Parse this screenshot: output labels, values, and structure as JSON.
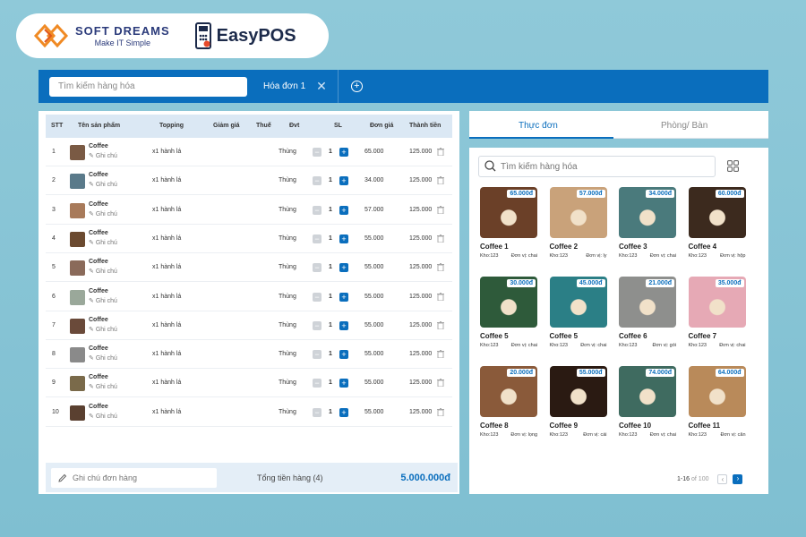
{
  "brand": {
    "softdreams_title": "SOFT DREAMS",
    "softdreams_slogan": "Make IT Simple",
    "easypos": "EasyPOS"
  },
  "topbar": {
    "search_placeholder": "Tìm kiếm hàng hóa",
    "invoice_tab": "Hóa đơn 1",
    "accent": "#0a6ebd"
  },
  "table": {
    "headers": [
      "STT",
      "Tên sản phẩm",
      "Topping",
      "Giảm giá",
      "Thuế",
      "Đvt",
      "SL",
      "Đơn giá",
      "Thành tiền"
    ],
    "rows": [
      {
        "stt": "1",
        "name": "Coffee",
        "note": "Ghi chú",
        "topping": "x1 hành lá",
        "unit": "Thùng",
        "qty": "1",
        "price": "65.000",
        "total": "125.000"
      },
      {
        "stt": "2",
        "name": "Coffee",
        "note": "Ghi chú",
        "topping": "x1 hành lá",
        "unit": "Thùng",
        "qty": "1",
        "price": "34.000",
        "total": "125.000"
      },
      {
        "stt": "3",
        "name": "Coffee",
        "note": "Ghi chú",
        "topping": "x1 hành lá",
        "unit": "Thùng",
        "qty": "1",
        "price": "57.000",
        "total": "125.000"
      },
      {
        "stt": "4",
        "name": "Coffee",
        "note": "Ghi chú",
        "topping": "x1 hành lá",
        "unit": "Thùng",
        "qty": "1",
        "price": "55.000",
        "total": "125.000"
      },
      {
        "stt": "5",
        "name": "Coffee",
        "note": "Ghi chú",
        "topping": "x1 hành lá",
        "unit": "Thùng",
        "qty": "1",
        "price": "55.000",
        "total": "125.000"
      },
      {
        "stt": "6",
        "name": "Coffee",
        "note": "Ghi chú",
        "topping": "x1 hành lá",
        "unit": "Thùng",
        "qty": "1",
        "price": "55.000",
        "total": "125.000"
      },
      {
        "stt": "7",
        "name": "Coffee",
        "note": "Ghi chú",
        "topping": "x1 hành lá",
        "unit": "Thùng",
        "qty": "1",
        "price": "55.000",
        "total": "125.000"
      },
      {
        "stt": "8",
        "name": "Coffee",
        "note": "Ghi chú",
        "topping": "x1 hành lá",
        "unit": "Thùng",
        "qty": "1",
        "price": "55.000",
        "total": "125.000"
      },
      {
        "stt": "9",
        "name": "Coffee",
        "note": "Ghi chú",
        "topping": "x1 hành lá",
        "unit": "Thùng",
        "qty": "1",
        "price": "55.000",
        "total": "125.000"
      },
      {
        "stt": "10",
        "name": "Coffee",
        "note": "Ghi chú",
        "topping": "x1 hành lá",
        "unit": "Thùng",
        "qty": "1",
        "price": "55.000",
        "total": "125.000"
      }
    ]
  },
  "footer": {
    "order_note_placeholder": "Ghi chú đơn hàng",
    "total_label": "Tổng tiền hàng (4)",
    "total_value": "5.000.000đ"
  },
  "tabs": {
    "menu": "Thực đơn",
    "tables": "Phòng/ Bàn"
  },
  "menu": {
    "search_placeholder": "Tìm kiếm hàng hóa",
    "items": [
      {
        "name": "Coffee 1",
        "price": "65.000đ",
        "stock": "Kho:123",
        "unit": "Đơn vị: chai",
        "img_color": "#6b4028"
      },
      {
        "name": "Coffee 2",
        "price": "57.000đ",
        "stock": "Kho:123",
        "unit": "Đơn vị: ly",
        "img_color": "#c9a27a"
      },
      {
        "name": "Coffee 3",
        "price": "34.000đ",
        "stock": "Kho:123",
        "unit": "Đơn vị: chai",
        "img_color": "#4a7a7c"
      },
      {
        "name": "Coffee 4",
        "price": "60.000đ",
        "stock": "Kho:123",
        "unit": "Đơn vị: hộp",
        "img_color": "#3c2a1e"
      },
      {
        "name": "Coffee 5",
        "price": "30.000đ",
        "stock": "Kho:123",
        "unit": "Đơn vị: chai",
        "img_color": "#2e5a3a"
      },
      {
        "name": "Coffee 5",
        "price": "45.000đ",
        "stock": "Kho:123",
        "unit": "Đơn vị: chai",
        "img_color": "#2b7f86"
      },
      {
        "name": "Coffee 6",
        "price": "21.000đ",
        "stock": "Kho:123",
        "unit": "Đơn vị: gói",
        "img_color": "#8e8f8d"
      },
      {
        "name": "Coffee 7",
        "price": "35.000đ",
        "stock": "Kho:123",
        "unit": "Đơn vị: chai",
        "img_color": "#e6a9b5"
      },
      {
        "name": "Coffee 8",
        "price": "20.000đ",
        "stock": "Kho:123",
        "unit": "Đơn vị: lọng",
        "img_color": "#8a5a3a"
      },
      {
        "name": "Coffee 9",
        "price": "55.000đ",
        "stock": "Kho:123",
        "unit": "Đơn vị: cái",
        "img_color": "#2a1a12"
      },
      {
        "name": "Coffee 10",
        "price": "74.000đ",
        "stock": "Kho:123",
        "unit": "Đơn vị: chai",
        "img_color": "#3f6b60"
      },
      {
        "name": "Coffee 11",
        "price": "64.000đ",
        "stock": "Kho:123",
        "unit": "Đơn vị: cân",
        "img_color": "#b98a5a"
      }
    ],
    "pagination_range": "1-16",
    "pagination_of": "of 100"
  }
}
